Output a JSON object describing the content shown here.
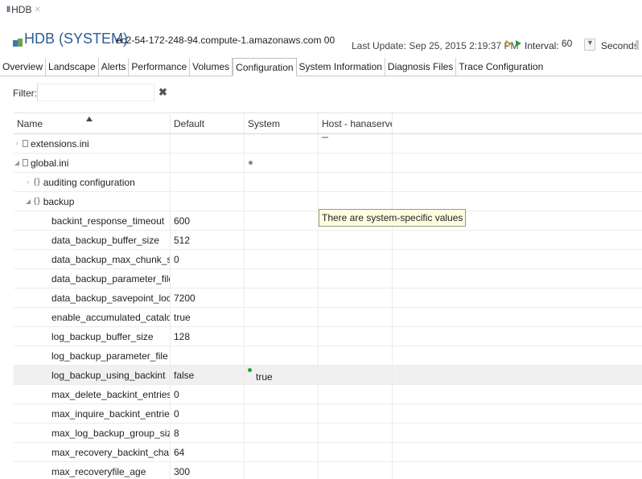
{
  "editor_tab": {
    "label": "HDB"
  },
  "header": {
    "title": "HDB (SYSTEM)",
    "host": "ec2-54-172-248-94.compute-1.amazonaws.com 00",
    "last_update": "Last Update: Sep 25, 2015 2:19:37 PM",
    "interval_label": "Interval:",
    "interval_value": "60",
    "seconds_label": "Seconds"
  },
  "tabs": [
    {
      "label": "Overview"
    },
    {
      "label": "Landscape"
    },
    {
      "label": "Alerts"
    },
    {
      "label": "Performance"
    },
    {
      "label": "Volumes"
    },
    {
      "label": "Configuration",
      "active": true
    },
    {
      "label": "System Information"
    },
    {
      "label": "Diagnosis Files"
    },
    {
      "label": "Trace Configuration"
    }
  ],
  "filter": {
    "label": "Filter:",
    "value": ""
  },
  "table": {
    "columns": [
      "Name",
      "Default",
      "System",
      "Host - hanaserver"
    ],
    "rows": [
      {
        "name": "extensions.ini",
        "default": "",
        "system": "",
        "host": ""
      },
      {
        "name": "global.ini",
        "default": "",
        "system": "",
        "host": ""
      },
      {
        "name": "auditing configuration",
        "default": "",
        "system": "",
        "host": ""
      },
      {
        "name": "backup",
        "default": "",
        "system": "",
        "host": ""
      },
      {
        "name": "backint_response_timeout",
        "default": "600",
        "system": "",
        "host": ""
      },
      {
        "name": "data_backup_buffer_size",
        "default": "512",
        "system": "",
        "host": ""
      },
      {
        "name": "data_backup_max_chunk_size",
        "default": "0",
        "system": "",
        "host": ""
      },
      {
        "name": "data_backup_parameter_file",
        "default": "",
        "system": "",
        "host": ""
      },
      {
        "name": "data_backup_savepoint_lock_tim",
        "default": "7200",
        "system": "",
        "host": ""
      },
      {
        "name": "enable_accumulated_catalog_bac",
        "default": "true",
        "system": "",
        "host": ""
      },
      {
        "name": "log_backup_buffer_size",
        "default": "128",
        "system": "",
        "host": ""
      },
      {
        "name": "log_backup_parameter_file",
        "default": "",
        "system": "",
        "host": ""
      },
      {
        "name": "log_backup_using_backint",
        "default": "false",
        "system": "true",
        "host": ""
      },
      {
        "name": "max_delete_backint_entries",
        "default": "0",
        "system": "",
        "host": ""
      },
      {
        "name": "max_inquire_backint_entries",
        "default": "0",
        "system": "",
        "host": ""
      },
      {
        "name": "max_log_backup_group_size",
        "default": "8",
        "system": "",
        "host": ""
      },
      {
        "name": "max_recovery_backint_channels",
        "default": "64",
        "system": "",
        "host": ""
      },
      {
        "name": "max_recoveryfile_age",
        "default": "300",
        "system": "",
        "host": ""
      }
    ]
  },
  "tooltip": {
    "text": "There are system-specific values"
  },
  "colors": {
    "title_blue": "#2a5d9a",
    "changed_green": "#25a035",
    "tooltip_bg": "#fdfde0"
  }
}
